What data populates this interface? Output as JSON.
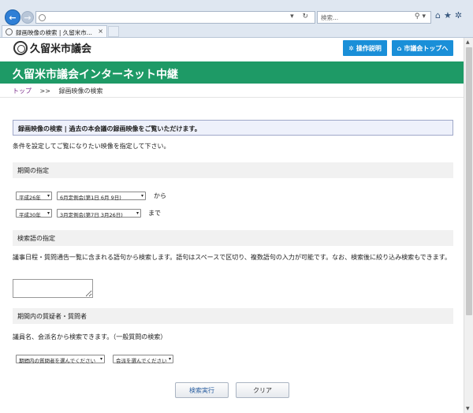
{
  "browser": {
    "search_placeholder": "検索...",
    "tab_title": "録画映像の検索 | 久留米市...",
    "tab_close": "×"
  },
  "header": {
    "logo_text": "久留米市議会",
    "help_button": "操作説明",
    "top_button": "市議会トップへ"
  },
  "banner": {
    "title": "久留米市議会インターネット中継"
  },
  "breadcrumb": {
    "home": "トップ",
    "sep": ">>",
    "current": "録画映像の検索"
  },
  "notice": {
    "text": "録画映像の検索 | 過去の本会議の録画映像をご覧いただけます。"
  },
  "instructions": "条件を設定してご覧になりたい映像を指定して下さい。",
  "period": {
    "heading": "期間の指定",
    "from_year": "平成26年",
    "from_session": "6月定例会(第1日 6月 9日)",
    "from_label": "から",
    "to_year": "平成30年",
    "to_session": "3月定例会(第7日 3月26日)",
    "to_label": "まで"
  },
  "keyword": {
    "heading": "検索語の指定",
    "description": "議事日程・質問通告一覧に含まれる語句から検索します。語句はスペースで区切り、複数語句の入力が可能です。なお、検索後に絞り込み検索もできます。"
  },
  "speaker": {
    "heading": "期間内の質疑者・質問者",
    "description": "議員名、会派名から検索できます。（一般質問の検索）",
    "person_select": "期間内の質問者を選んでください",
    "faction_select": "会派を選んでください"
  },
  "actions": {
    "search": "検索実行",
    "clear": "クリア"
  }
}
